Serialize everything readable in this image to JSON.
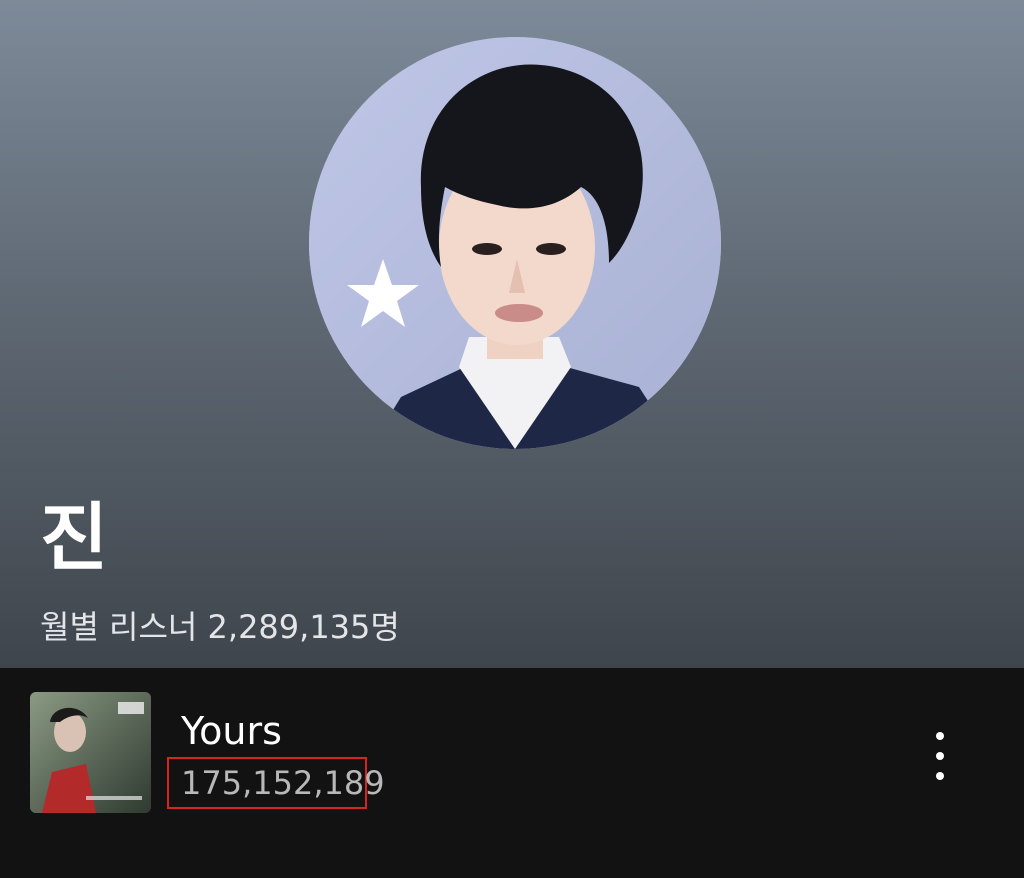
{
  "artist": {
    "name": "진",
    "monthly_listeners": "월별 리스너 2,289,135명",
    "photo_icon": "artist-photo"
  },
  "tracks": [
    {
      "title": "Yours",
      "plays": "175,152,189",
      "cover_icon": "album-cover",
      "more_icon": "more-vertical-icon"
    }
  ],
  "colors": {
    "background": "#121212",
    "hero_top": "#7d8a99",
    "hero_bottom": "#3f454c",
    "text_primary": "#ffffff",
    "text_secondary": "#b8b8b8",
    "highlight_box": "#d62424"
  }
}
